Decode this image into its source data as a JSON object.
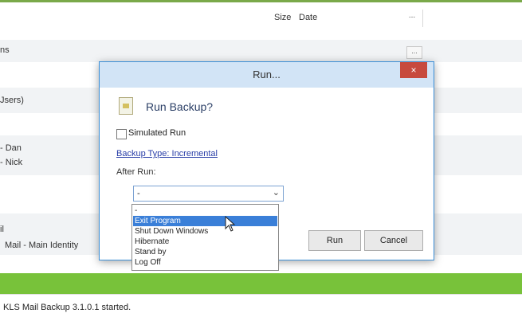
{
  "background": {
    "columns": {
      "size": "Size",
      "date": "Date",
      "more": "..."
    },
    "items": [
      "ns",
      "Jsers)",
      "- Dan",
      "- Nick",
      "il",
      "Mail - Main Identity"
    ],
    "mini_button": "...",
    "status_text": "KLS Mail Backup 3.1.0.1 started."
  },
  "dialog": {
    "title": "Run...",
    "close_label": "×",
    "heading": "Run Backup?",
    "simulated_run_label": "Simulated Run",
    "backup_type_link": "Backup Type: Incremental",
    "after_run_label": "After Run:",
    "after_run_value": "-",
    "after_run_options": [
      "-",
      "Exit Program",
      "Shut Down Windows",
      "Hibernate",
      "Stand by",
      "Log Off"
    ],
    "highlighted_option": "Exit Program",
    "run_button": "Run",
    "cancel_button": "Cancel"
  },
  "colors": {
    "accent_green": "#78c23a",
    "titlebar": "#d2e4f6",
    "close_red": "#c74a3d",
    "selection_blue": "#3a7fd8"
  }
}
